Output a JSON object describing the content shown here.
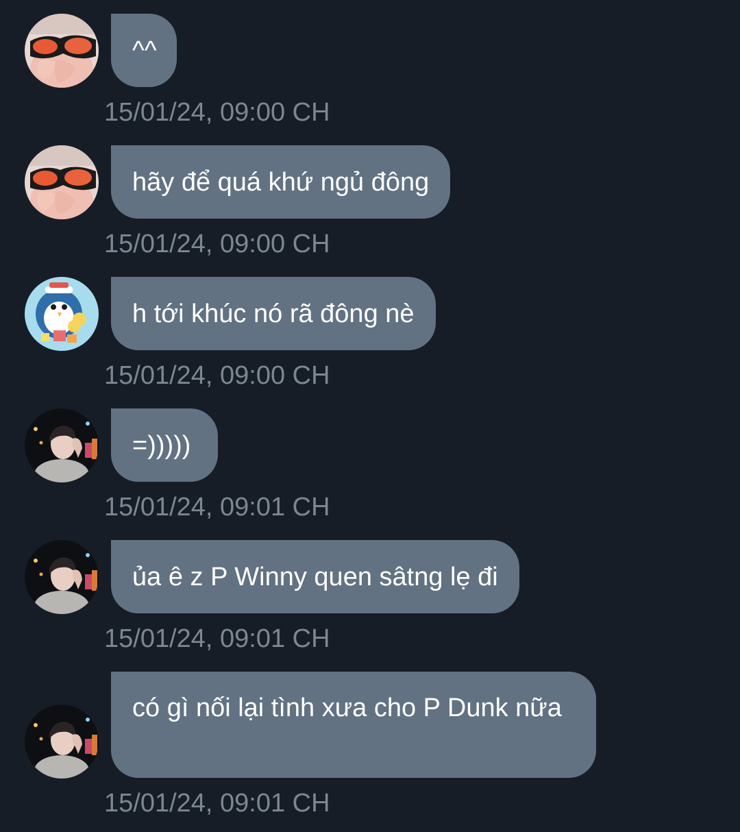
{
  "messages": [
    {
      "avatar": "glasses-avatar",
      "text": "^^",
      "time": "15/01/24, 09:00 CH"
    },
    {
      "avatar": "glasses-avatar",
      "text": "hãy để quá khứ ngủ đông",
      "time": "15/01/24, 09:00 CH"
    },
    {
      "avatar": "penguin-avatar",
      "text": "h tới khúc nó rã đông nè",
      "time": "15/01/24, 09:00 CH"
    },
    {
      "avatar": "night-selfie-avatar",
      "text": "=)))))",
      "time": "15/01/24, 09:01 CH"
    },
    {
      "avatar": "night-selfie-avatar",
      "text": "ủa ê z P Winny quen sâtng lẹ đi",
      "time": "15/01/24, 09:01 CH"
    },
    {
      "avatar": "night-selfie-avatar",
      "text": "có gì nối lại tình xưa cho P Dunk nữa",
      "time": "15/01/24, 09:01 CH"
    }
  ],
  "colors": {
    "background": "#161d27",
    "bubble": "#627282",
    "timestamp": "#7c8792"
  }
}
